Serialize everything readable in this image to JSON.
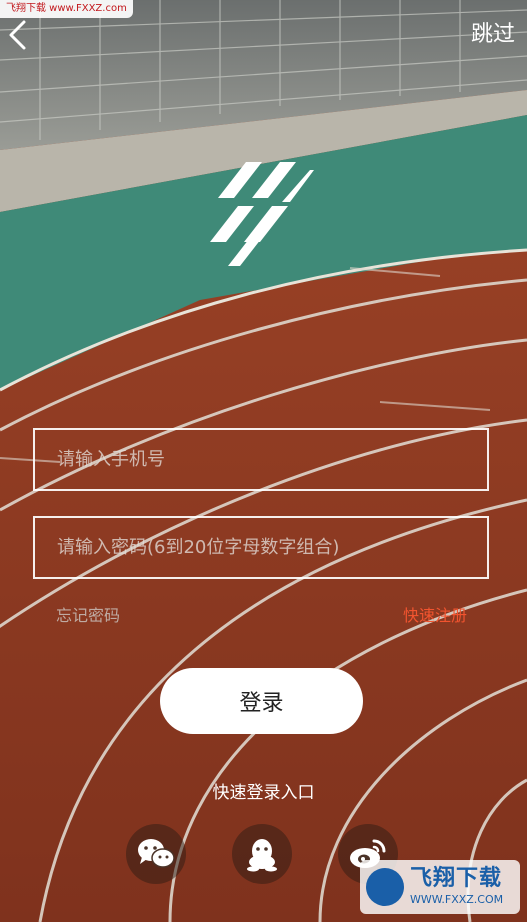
{
  "watermark_top": "飞翔下载 www.FXXZ.com",
  "header": {
    "back_icon": "chevron-left-icon",
    "skip_label": "跳过"
  },
  "logo": {
    "icon": "app-logo-stripes"
  },
  "form": {
    "phone_placeholder": "请输入手机号",
    "password_placeholder": "请输入密码(6到20位字母数字组合)",
    "forgot_label": "忘记密码",
    "register_label": "快速注册",
    "login_label": "登录"
  },
  "quick_login": {
    "title": "快速登录入口",
    "options": [
      {
        "icon": "wechat-icon"
      },
      {
        "icon": "qq-icon"
      },
      {
        "icon": "weibo-icon"
      }
    ]
  },
  "watermark_bottom": {
    "brand": "飞翔下载",
    "url": "WWW.FXXZ.COM"
  },
  "colors": {
    "track_red": "#8f3a22",
    "turf_green": "#3f8a78",
    "register_accent": "#f2542f",
    "button_bg": "#ffffff"
  }
}
